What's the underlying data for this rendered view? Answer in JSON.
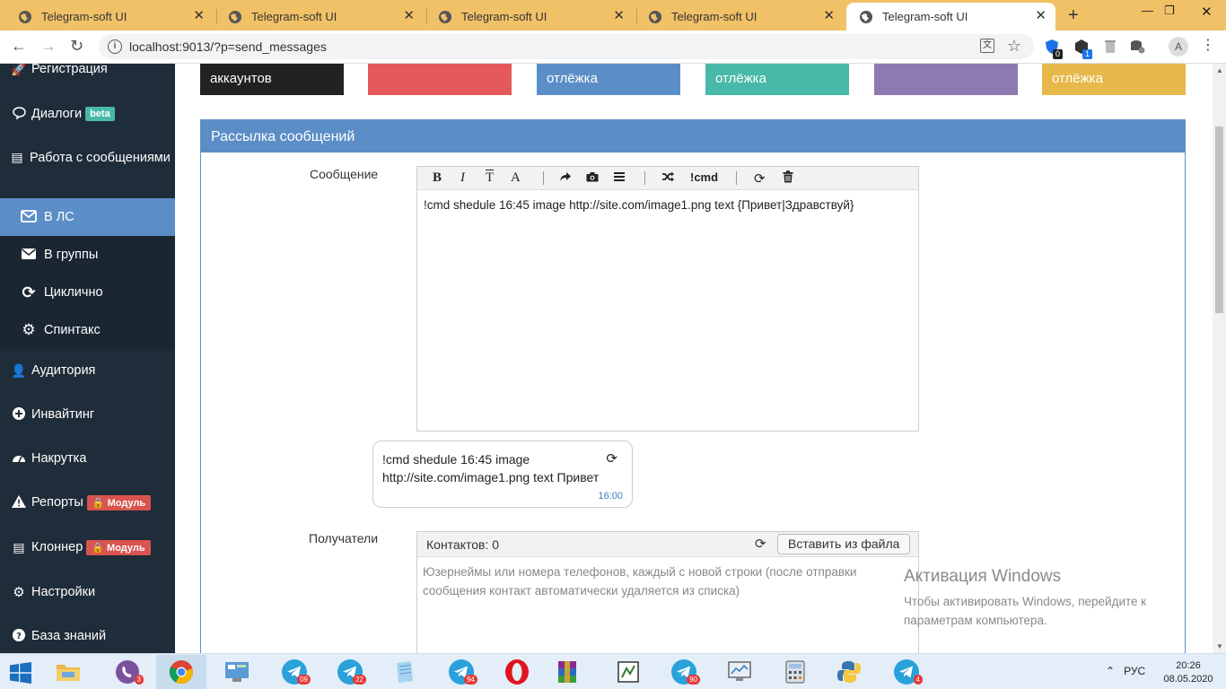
{
  "browser": {
    "tabs": [
      {
        "title": "Telegram-soft UI",
        "active": false
      },
      {
        "title": "Telegram-soft UI",
        "active": false
      },
      {
        "title": "Telegram-soft UI",
        "active": false
      },
      {
        "title": "Telegram-soft UI",
        "active": false
      },
      {
        "title": "Telegram-soft UI",
        "active": true
      }
    ],
    "url": "localhost:9013/?p=send_messages",
    "profile_initial": "A",
    "ext_badges": [
      "0",
      "1"
    ]
  },
  "sidebar": {
    "items": [
      {
        "label": "Регистрация",
        "icon": "rocket-icon"
      },
      {
        "label": "Диалоги",
        "icon": "chat-icon",
        "badge": "beta"
      },
      {
        "label": "Работа с сообщениями",
        "icon": "list-icon"
      },
      {
        "label": "В ЛС",
        "icon": "envelope-outline-icon",
        "active": true
      },
      {
        "label": "В группы",
        "icon": "envelope-icon"
      },
      {
        "label": "Циклично",
        "icon": "refresh-icon"
      },
      {
        "label": "Спинтакс",
        "icon": "gears-icon"
      },
      {
        "label": "Аудитория",
        "icon": "users-icon"
      },
      {
        "label": "Инвайтинг",
        "icon": "plus-circle-icon"
      },
      {
        "label": "Накрутка",
        "icon": "dashboard-icon"
      },
      {
        "label": "Репорты",
        "icon": "warning-icon",
        "badge": "Модуль"
      },
      {
        "label": "Клоннер",
        "icon": "clone-icon",
        "badge": "Модуль"
      },
      {
        "label": "Настройки",
        "icon": "gear-icon"
      },
      {
        "label": "База знаний",
        "icon": "question-icon"
      }
    ]
  },
  "stats": [
    {
      "label": "аккаунтов",
      "color": "#222222"
    },
    {
      "label": "",
      "color": "#e5585c"
    },
    {
      "label": "отлёжка",
      "color": "#5b8ec7"
    },
    {
      "label": "отлёжка",
      "color": "#48b9a8"
    },
    {
      "label": "",
      "color": "#8e79b0"
    },
    {
      "label": "отлёжка",
      "color": "#e7b84a"
    }
  ],
  "panel": {
    "title": "Рассылка сообщений",
    "message_label": "Сообщение",
    "message_text": "!cmd shedule 16:45 image http://site.com/image1.png text {Привет|Здравствуй}",
    "toolbar": {
      "bold": "B",
      "italic": "I",
      "clear": "T",
      "font": "A",
      "cmd": "!cmd"
    },
    "preview": {
      "text": "!cmd shedule 16:45 image http://site.com/image1.png text Привет",
      "time": "16:00"
    },
    "recipients_label": "Получатели",
    "contacts": "Контактов: 0",
    "insert_button": "Вставить из файла",
    "recipients_placeholder": "Юзернеймы или номера телефонов, каждый с новой строки (после отправки сообщения контакт автоматически удаляется из списка)"
  },
  "watermark": {
    "title": "Активация Windows",
    "text": "Чтобы активировать Windows, перейдите к параметрам компьютера."
  },
  "taskbar": {
    "badges": [
      "3",
      "09",
      "22",
      "94",
      "90",
      "4"
    ],
    "lang": "РУС",
    "time": "20:26",
    "date": "08.05.2020"
  }
}
